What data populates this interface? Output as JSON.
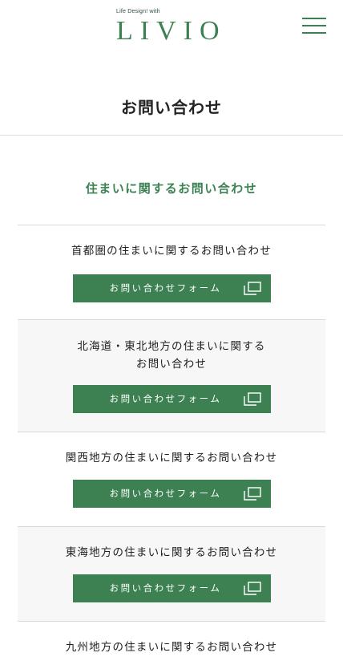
{
  "header": {
    "logo_tagline": "Life Design! with",
    "logo_wordmark": "LIVIO",
    "menu_icon": "hamburger-menu-icon",
    "brand_color": "#3d8153"
  },
  "page": {
    "title": "お問い合わせ"
  },
  "section": {
    "heading": "住まいに関するお問い合わせ"
  },
  "blocks": [
    {
      "title_lines": [
        "首都圏の住まいに関するお問い合わせ"
      ],
      "button_label": "お問い合わせフォーム",
      "button_icon": "external-window-icon"
    },
    {
      "title_lines": [
        "北海道・東北地方の住まいに関する",
        "お問い合わせ"
      ],
      "button_label": "お問い合わせフォーム",
      "button_icon": "external-window-icon"
    },
    {
      "title_lines": [
        "関西地方の住まいに関するお問い合わせ"
      ],
      "button_label": "お問い合わせフォーム",
      "button_icon": "external-window-icon"
    },
    {
      "title_lines": [
        "東海地方の住まいに関するお問い合わせ"
      ],
      "button_label": "お問い合わせフォーム",
      "button_icon": "external-window-icon"
    },
    {
      "title_lines": [
        "九州地方の住まいに関するお問い合わせ"
      ]
    }
  ]
}
